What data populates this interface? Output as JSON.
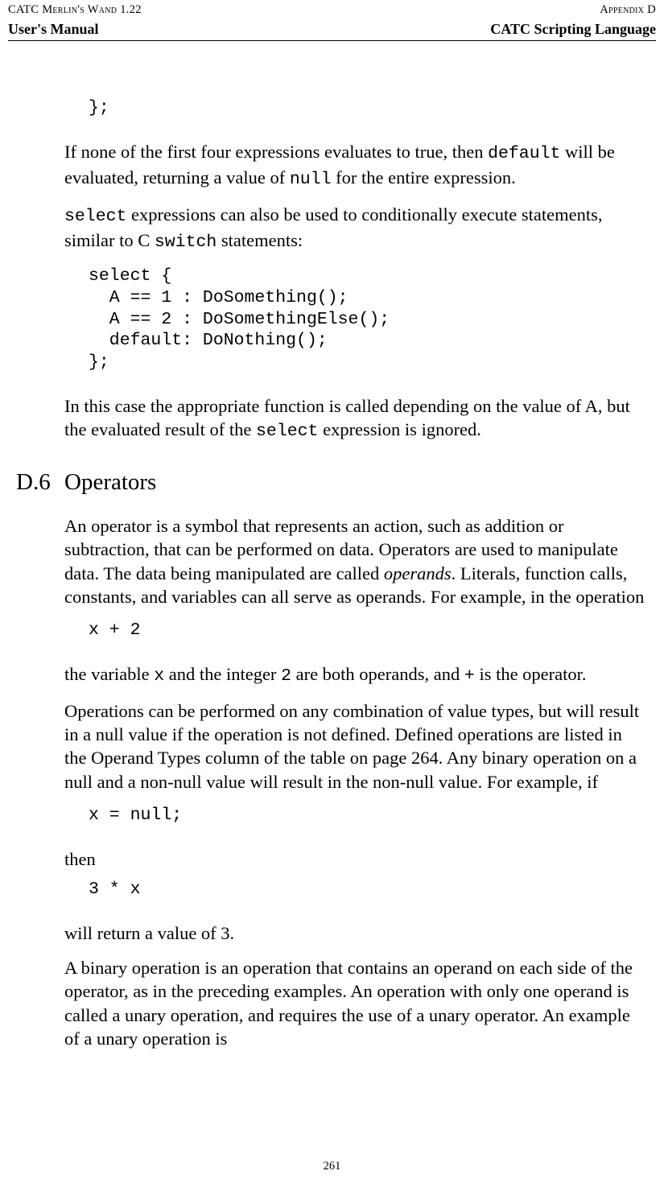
{
  "header": {
    "topLeft": "CATC Merlin's Wand 1.22",
    "topRight": "Appendix D",
    "secondLeft": "User's Manual",
    "secondRight": "CATC Scripting Language"
  },
  "code": {
    "frag1": "};",
    "selectBlock": "select {\n  A == 1 : DoSomething();\n  A == 2 : DoSomethingElse();\n  default: DoNothing();\n};",
    "xplus2": "x + 2",
    "xnull": "x = null;",
    "threex": "3 * x"
  },
  "inline": {
    "default": "default",
    "null": "null",
    "select": "select",
    "switch": "switch",
    "x": "x",
    "two": "2",
    "plus": "+"
  },
  "text": {
    "p1a": "If none of the first four expressions evaluates to true, then ",
    "p1b": " will be evaluated, returning a value of ",
    "p1c": " for the entire expression.",
    "p2a": " expressions can also be used to conditionally execute statements, similar to C ",
    "p2b": " statements:",
    "p3a": "In this case the appropriate function is called depending on the value of A, but the evaluated result of the ",
    "p3b": " expression is ignored.",
    "sectionNumber": "D.6",
    "sectionTitle": "Operators",
    "p4a": "An operator is a symbol that represents an action, such as addition or subtraction, that can be performed on data. Operators are used to manipulate data. The data being manipulated are called ",
    "operands": "operands",
    "p4b": ". Literals, function calls, constants, and variables can all serve as operands. For example, in the operation",
    "p5a": "the variable ",
    "p5b": " and the integer ",
    "p5c": " are both operands, and ",
    "p5d": " is the operator.",
    "p6": "Operations can be performed on any combination of value types, but will result in a null value if the operation is not defined. Defined operations are listed in the Operand Types column of the table on page 264. Any binary operation on a null and a non-null value will result in the non-null value. For example, if",
    "then": "then",
    "p7": "will return a value of 3.",
    "p8": "A binary operation is an operation that contains an operand on each side of the operator, as in the preceding examples. An operation with only one operand is called a unary operation, and requires the use of a unary operator. An example of a unary operation is"
  },
  "pageNumber": "261"
}
